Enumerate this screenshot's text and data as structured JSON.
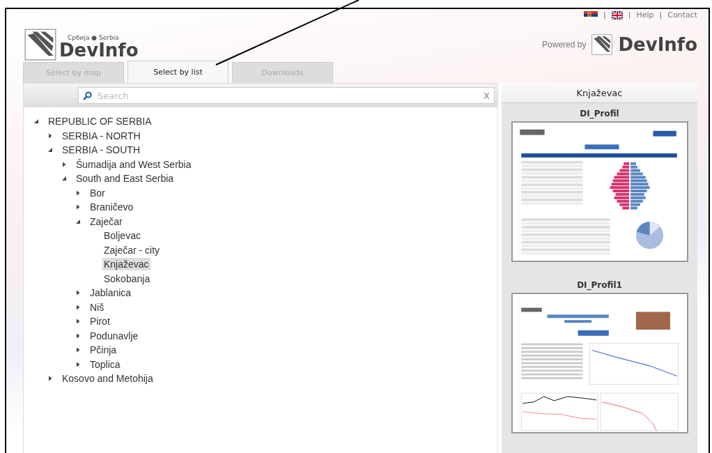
{
  "header": {
    "logo": {
      "country": "Србија ● Serbia",
      "brand": "DevInfo"
    },
    "top_links": [
      {
        "kind": "flag-rs"
      },
      {
        "kind": "sep",
        "text": "|"
      },
      {
        "kind": "flag-uk"
      },
      {
        "kind": "sep",
        "text": "|"
      },
      {
        "kind": "link",
        "text": "Help"
      },
      {
        "kind": "sep",
        "text": "|"
      },
      {
        "kind": "link",
        "text": "Contact"
      }
    ],
    "powered_by": {
      "text": "Powered by",
      "brand": "DevInfo"
    }
  },
  "tabs": [
    {
      "label": "Select by map",
      "selected": false
    },
    {
      "label": "Select by list",
      "selected": true
    },
    {
      "label": "Downloads",
      "selected": false
    }
  ],
  "search": {
    "placeholder": "Search",
    "clear": "X"
  },
  "tree": [
    {
      "label": "REPUBLIC OF SERBIA",
      "kind": "group",
      "expanded": true,
      "selected": false,
      "children": [
        {
          "label": "SERBIA - NORTH",
          "kind": "group",
          "expanded": false,
          "selected": false
        },
        {
          "label": "SERBIA - SOUTH",
          "kind": "group",
          "expanded": true,
          "selected": false,
          "children": [
            {
              "label": "Šumadija and West Serbia",
              "kind": "group",
              "expanded": false,
              "selected": false
            },
            {
              "label": "South and East Serbia",
              "kind": "group",
              "expanded": true,
              "selected": false,
              "children": [
                {
                  "label": "Bor",
                  "kind": "group",
                  "expanded": false,
                  "selected": false
                },
                {
                  "label": "Braničevo",
                  "kind": "group",
                  "expanded": false,
                  "selected": false
                },
                {
                  "label": "Zaječar",
                  "kind": "group",
                  "expanded": true,
                  "selected": false,
                  "children": [
                    {
                      "label": "Boljevac",
                      "kind": "place",
                      "selected": false
                    },
                    {
                      "label": "Zaječar - city",
                      "kind": "place",
                      "selected": false
                    },
                    {
                      "label": "Knjaževac",
                      "kind": "place",
                      "selected": true
                    },
                    {
                      "label": "Sokobanja",
                      "kind": "place",
                      "selected": false
                    }
                  ]
                },
                {
                  "label": "Jablanica",
                  "kind": "group",
                  "expanded": false,
                  "selected": false
                },
                {
                  "label": "Niš",
                  "kind": "group",
                  "expanded": false,
                  "selected": false
                },
                {
                  "label": "Pirot",
                  "kind": "group",
                  "expanded": false,
                  "selected": false
                },
                {
                  "label": "Podunavlje",
                  "kind": "group",
                  "expanded": false,
                  "selected": false
                },
                {
                  "label": "Pčinja",
                  "kind": "group",
                  "expanded": false,
                  "selected": false
                },
                {
                  "label": "Toplica",
                  "kind": "group",
                  "expanded": false,
                  "selected": false
                }
              ]
            }
          ]
        },
        {
          "label": "Kosovo and Metohija",
          "kind": "group",
          "expanded": false,
          "selected": false
        }
      ]
    }
  ],
  "details": {
    "title": "Knjaževac",
    "documents": [
      {
        "title": "DI_Profil",
        "kind": "pyramid"
      },
      {
        "title": "DI_Profil1",
        "kind": "trend"
      }
    ]
  }
}
